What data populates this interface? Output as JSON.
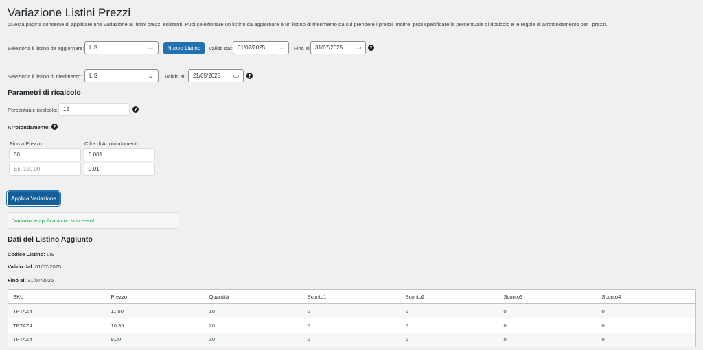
{
  "page": {
    "title": "Variazione Listini Prezzi",
    "description": "Questa pagina consente di applicare una variazione ai listini prezzi esistenti. Puoi selezionare un listino da aggiornare e un listino di riferimento da cui prendere i prezzi. Inoltre, puoi specificare la percentuale di ricalcolo e le regole di arrotondamento per i prezzi."
  },
  "update_row": {
    "label": "Seleziona il listino da aggiornare:",
    "selected": "LIS",
    "new_button": "Nuovo Listino",
    "valid_from_label": "Valido dal:",
    "valid_from": "01/07/2025",
    "valid_to_label": "Fino al:",
    "valid_to": "31/07/2025"
  },
  "reference_row": {
    "label": "Seleziona il listino di riferimento:",
    "selected": "LIS",
    "valid_on_label": "Valido al:",
    "valid_on": "21/05/2025"
  },
  "params": {
    "heading": "Parametri di ricalcolo",
    "percent_label": "Percentuale ricalcolo:",
    "percent_value": "15",
    "rounding_label": "Arrotondamento:",
    "col_price": "Fino a Prezzo",
    "col_digit": "Cifra di Arrotondamento",
    "rows": [
      {
        "price": "50",
        "digit": "0.001"
      },
      {
        "price_placeholder": "Es. 100.00",
        "digit": "0.01"
      }
    ],
    "apply_button": "Applica Variazione"
  },
  "notice": "Variazione applicata con successo!",
  "added": {
    "heading": "Dati del Listino Aggiunto",
    "code_label": "Codice Listino:",
    "code": "LIS",
    "from_label": "Valido dal:",
    "from": "01/07/2025",
    "to_label": "Fino al:",
    "to": "31/07/2025"
  },
  "table": {
    "headers": [
      "SKU",
      "Prezzo",
      "Quantità",
      "Sconto1",
      "Sconto2",
      "Sconto3",
      "Sconto4"
    ],
    "rows": [
      [
        "TPTAZ4",
        "11.50",
        "10",
        "0",
        "0",
        "0",
        "0"
      ],
      [
        "TPTAZ4",
        "10.35",
        "20",
        "0",
        "0",
        "0",
        "0"
      ],
      [
        "TPTAZ4",
        "9.20",
        "30",
        "0",
        "0",
        "0",
        "0"
      ]
    ]
  },
  "colors": {
    "primary": "#2271b1",
    "background": "#f0f0f1",
    "success": "#00a32a"
  }
}
